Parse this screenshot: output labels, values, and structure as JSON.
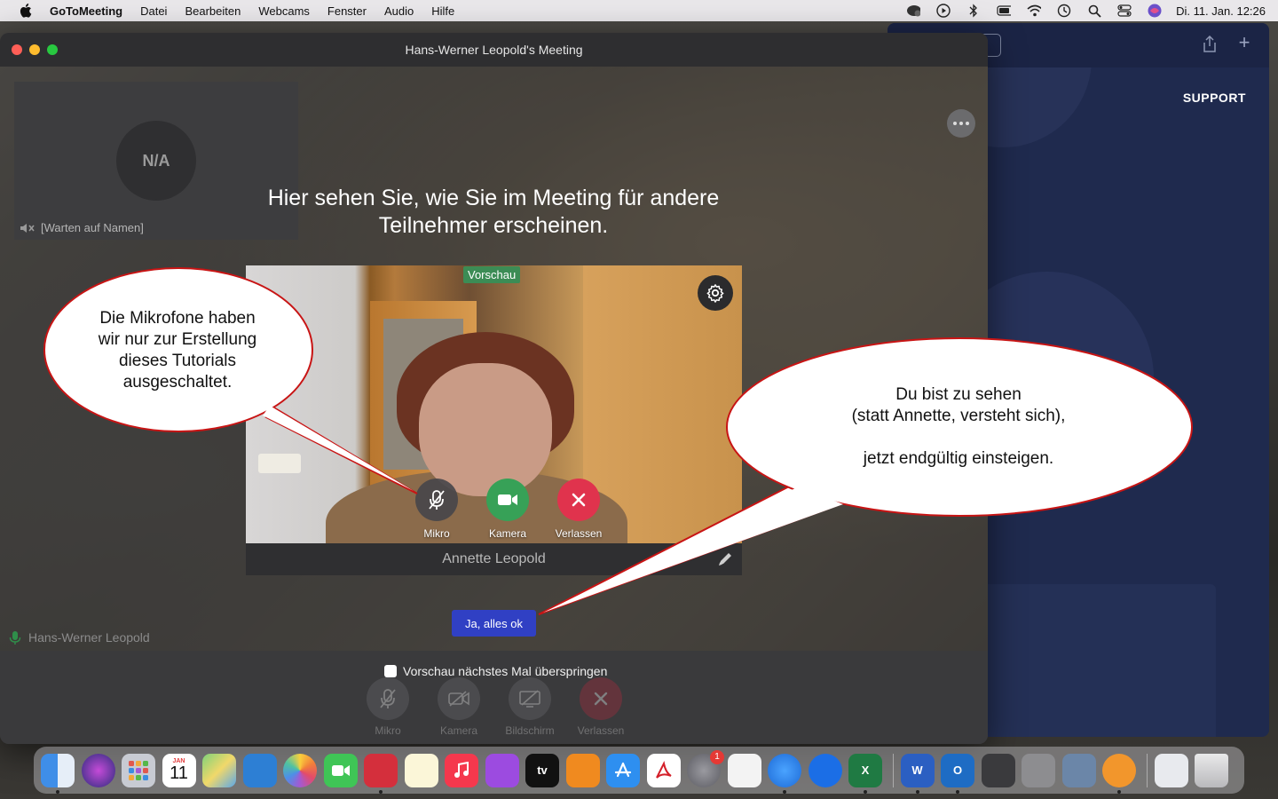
{
  "menubar": {
    "app_name": "GoToMeeting",
    "menus": [
      "Datei",
      "Bearbeiten",
      "Webcams",
      "Fenster",
      "Audio",
      "Hilfe"
    ],
    "clock": "Di. 11. Jan.  12:26"
  },
  "background_window": {
    "support_label": "SUPPORT"
  },
  "meeting_window": {
    "title": "Hans-Werner Leopold's Meeting",
    "tile_avatar": "N/A",
    "tile_name": "[Warten auf Namen]",
    "headline": "Hier sehen Sie, wie Sie im Meeting für andere Teilnehmer erscheinen.",
    "preview_badge": "Vorschau",
    "preview_controls": {
      "mic": "Mikro",
      "camera": "Kamera",
      "leave": "Verlassen"
    },
    "preview_name": "Annette Leopold",
    "ok_button": "Ja, alles ok",
    "background_participant": "Hans-Werner Leopold",
    "skip_checkbox_label": "Vorschau nächstes Mal überspringen",
    "main_controls": {
      "mic": "Mikro",
      "camera": "Kamera",
      "screen": "Bildschirm",
      "leave": "Verlassen"
    }
  },
  "callouts": {
    "left": "Die Mikrofone haben\nwir nur zur Erstellung\ndieses Tutorials\nausgeschaltet.",
    "right": "Du bist zu sehen\n(statt Annette, versteht sich),\n\njetzt endgültig einsteigen."
  },
  "dock": {
    "calendar_month": "JAN",
    "calendar_day": "11",
    "settings_badge": "1",
    "tv_label": "tv",
    "items": [
      "finder-icon",
      "siri-icon",
      "launchpad-icon",
      "calendar-icon",
      "maps-icon",
      "keynote-icon",
      "photos-icon",
      "facetime-icon",
      "photo-booth-icon",
      "notes-icon",
      "music-icon",
      "podcasts-icon",
      "apple-tv-icon",
      "books-icon",
      "app-store-icon",
      "acrobat-icon",
      "system-preferences-icon",
      "textedit-icon",
      "safari-icon",
      "teamviewer-icon",
      "excel-icon",
      "word-icon",
      "outlook-icon",
      "scanner-icon",
      "printer-icon",
      "preview-icon",
      "gotomeeting-icon",
      "screenshot-folder-icon",
      "trash-icon"
    ]
  },
  "colors": {
    "accent_button": "#3040c4",
    "camera_green": "#37a157",
    "leave_red": "#e0334d",
    "callout_border": "#cc1111"
  }
}
